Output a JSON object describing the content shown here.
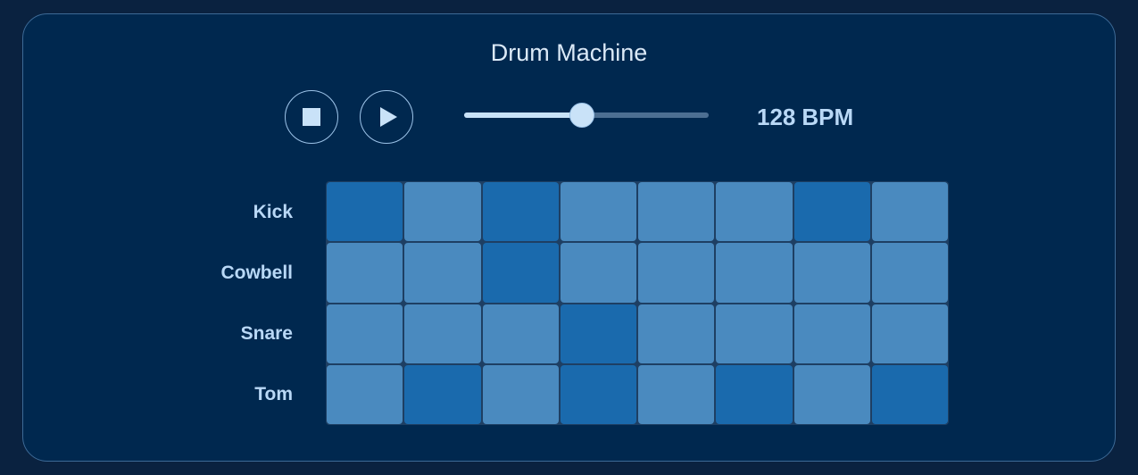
{
  "app": {
    "title": "Drum Machine"
  },
  "transport": {
    "stop_icon": "stop-icon",
    "play_icon": "play-icon"
  },
  "tempo": {
    "bpm_value": "128",
    "bpm_unit": "BPM",
    "slider_fraction": 0.48
  },
  "colors": {
    "background": "#0a2240",
    "panel": "#00284f",
    "step_on": "#1a6aad",
    "step_off": "#4a8abf",
    "text": "#b9d8f6"
  },
  "sequencer": {
    "steps": 8,
    "rows": [
      {
        "label": "Kick",
        "pattern": [
          1,
          0,
          1,
          0,
          0,
          0,
          1,
          0
        ]
      },
      {
        "label": "Cowbell",
        "pattern": [
          0,
          0,
          1,
          0,
          0,
          0,
          0,
          0
        ]
      },
      {
        "label": "Snare",
        "pattern": [
          0,
          0,
          0,
          1,
          0,
          0,
          0,
          0
        ]
      },
      {
        "label": "Tom",
        "pattern": [
          0,
          1,
          0,
          1,
          0,
          1,
          0,
          1
        ]
      }
    ]
  }
}
